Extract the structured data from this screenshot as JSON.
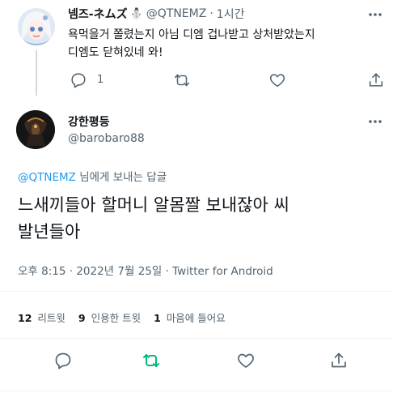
{
  "reply_to_tweet": {
    "display_name": "넴즈-ネムズ",
    "name_emoji": "⛄",
    "handle": "@QTNEMZ",
    "separator": "·",
    "time_ago": "1시간",
    "text_line1": "욕먹을거 쫄렸는지 아님 디엠 겁나받고 상처받았는지",
    "text_line2": "디엠도 닫혀있네 와!",
    "reply_count": "1"
  },
  "main_tweet": {
    "display_name": "강한평등",
    "handle": "@barobaro88",
    "reply_to_handle": "@QTNEMZ",
    "reply_to_suffix": " 님에게 보내는 답글",
    "text_line1": "느새끼들아 할머니 알몸짤 보내잖아 씨",
    "text_line2": "발년들아",
    "timestamp": "오후 8:15 · 2022년 7월 25일 · Twitter for Android"
  },
  "stats": {
    "retweets_count": "12",
    "retweets_label": "리트윗",
    "quotes_count": "9",
    "quotes_label": "인용한 트윗",
    "likes_count": "1",
    "likes_label": "마음에 들어요"
  },
  "colors": {
    "accent": "#1d9bf0",
    "retweet_green": "#00ba7c",
    "muted": "#536471",
    "divider": "#eff3f4"
  },
  "icons": [
    "more-icon",
    "reply-icon",
    "retweet-icon",
    "like-icon",
    "share-icon"
  ]
}
